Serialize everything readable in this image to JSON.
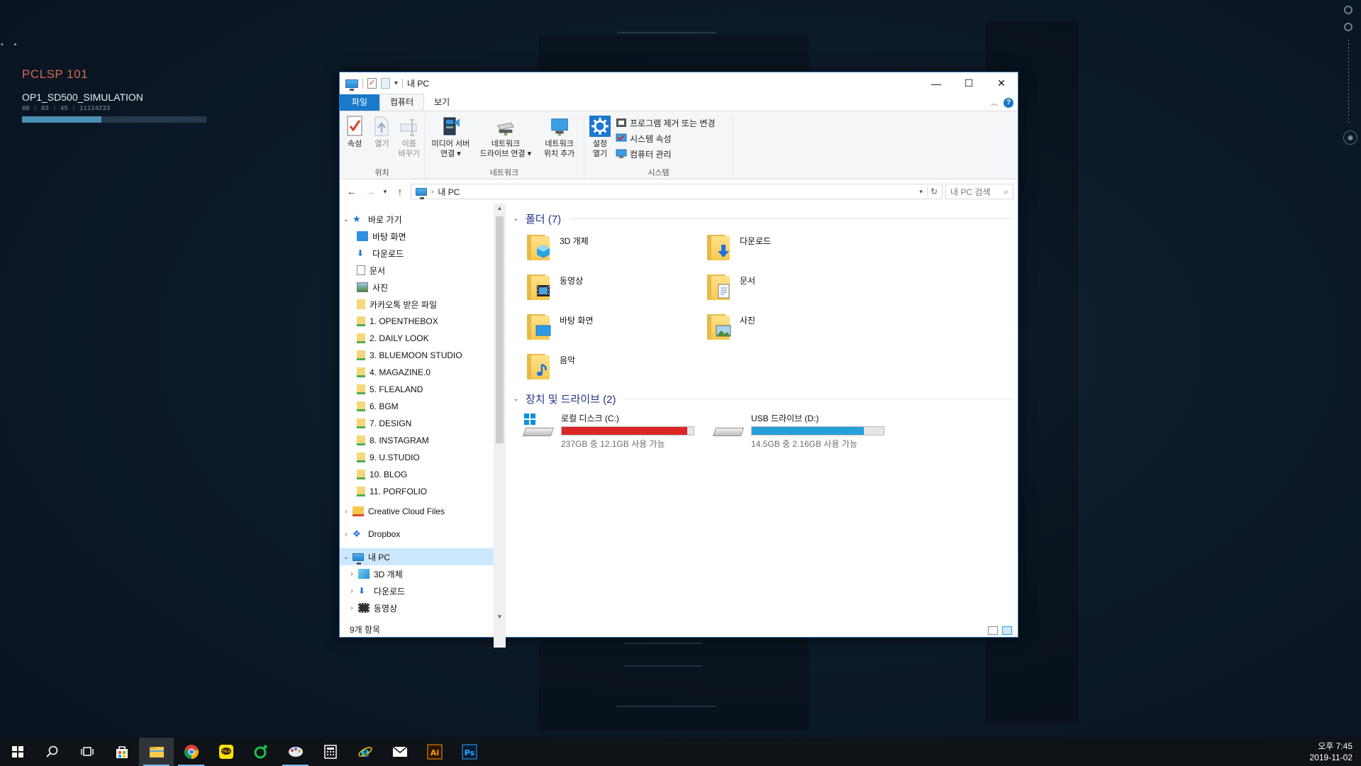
{
  "desktop": {
    "widget_title": "PCLSP 101",
    "widget_subtitle": "OP1_SD500_SIMULATION",
    "widget_time": "00 : 03 : 45 : 11114233",
    "widget_progress": 0.43
  },
  "window": {
    "title": "내 PC",
    "controls": {
      "minimize": "—",
      "maximize": "☐",
      "close": "✕"
    }
  },
  "tabs": {
    "file": "파일",
    "computer": "컴퓨터",
    "view": "보기"
  },
  "ribbon": {
    "location": {
      "label": "위치",
      "properties": "속성",
      "open": "열기",
      "rename_1": "이름",
      "rename_2": "바꾸기"
    },
    "network": {
      "label": "네트워크",
      "media_1": "미디어 서버",
      "media_2": "연결 ▾",
      "drive_1": "네트워크",
      "drive_2": "드라이브 연결 ▾",
      "loc_1": "네트워크",
      "loc_2": "위치 추가"
    },
    "system": {
      "label": "시스템",
      "settings_1": "설정",
      "settings_2": "열기",
      "uninstall": "프로그램 제거 또는 변경",
      "sys_props": "시스템 속성",
      "manage": "컴퓨터 관리"
    }
  },
  "address": {
    "path": "내 PC",
    "search_placeholder": "내 PC 검색"
  },
  "nav": {
    "quick_access": "바로 가기",
    "quick_items": [
      "바탕 화면",
      "다운로드",
      "문서",
      "사진",
      "카카오톡 받은 파일",
      "1. OPENTHEBOX",
      "2. DAILY LOOK",
      "3. BLUEMOON STUDIO",
      "4. MAGAZINE.0",
      "5. FLEALAND",
      "6. BGM",
      "7. DESIGN",
      "8. INSTAGRAM",
      "9. U.STUDIO",
      "10. BLOG",
      "11. PORFOLIO"
    ],
    "creative_cloud": "Creative Cloud Files",
    "dropbox": "Dropbox",
    "this_pc": "내 PC",
    "pc_items": [
      "3D 개체",
      "다운로드",
      "동영상"
    ]
  },
  "status": "9개 항목",
  "folders": {
    "heading": "폴더 (7)",
    "items": [
      "3D 개체",
      "다운로드",
      "동영상",
      "문서",
      "바탕 화면",
      "사진",
      "음악"
    ]
  },
  "drives": {
    "heading": "장치 및 드라이브 (2)",
    "items": [
      {
        "name": "로컬 디스크 (C:)",
        "free": "237GB 중 12.1GB 사용 가능",
        "used_fraction": 0.95,
        "color": "#da2626"
      },
      {
        "name": "USB 드라이브 (D:)",
        "free": "14.5GB 중 2.16GB 사용 가능",
        "used_fraction": 0.85,
        "color": "#26a0da"
      }
    ]
  },
  "taskbar": {
    "clock_time": "오후 7:45",
    "clock_date": "2019-11-02"
  }
}
